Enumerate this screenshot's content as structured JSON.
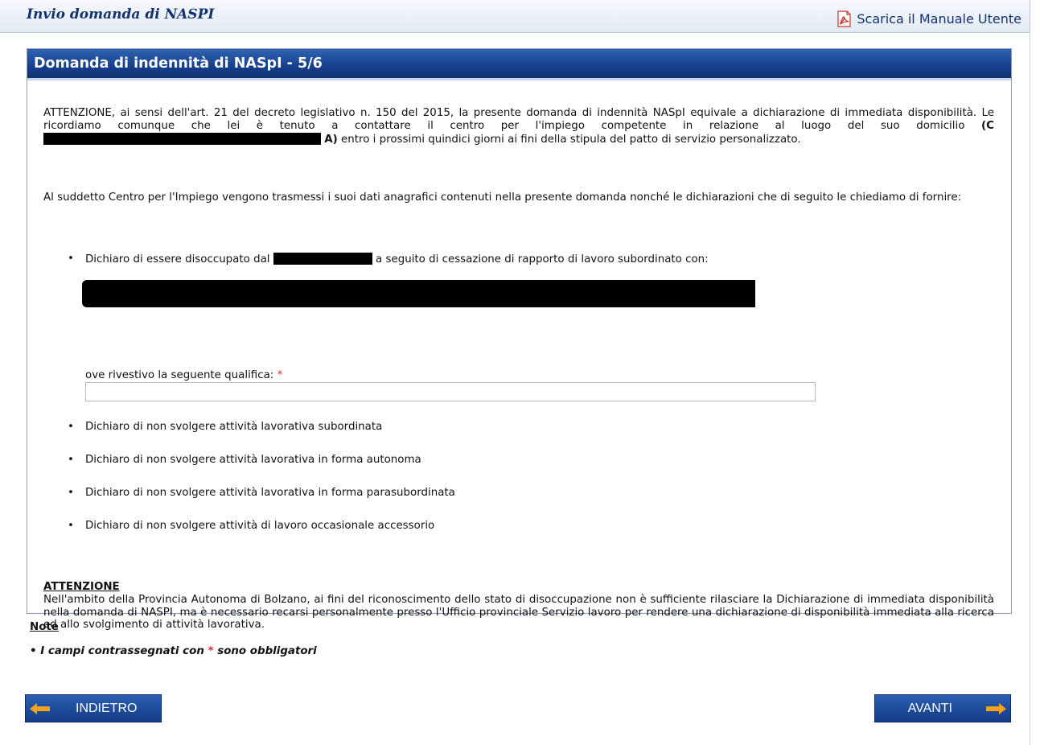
{
  "header": {
    "app_title": "Invio domanda di NASPI",
    "manual_link": "Scarica il Manuale Utente"
  },
  "panel": {
    "title": "Domanda di indennità di NASpI - 5/6",
    "para1_part1": "ATTENZIONE, ai sensi dell'art. 21 del decreto legislativo n. 150 del 2015, la presente domanda di indennità NASpI equivale a dichiarazione di immediata disponibilità. Le ricordiamo comunque che lei è tenuto a contattare il centro per l'impiego competente in relazione al luogo del suo domicilio ",
    "para1_bold_open": "(C",
    "para1_bold_close": "A)",
    "para1_part2": " entro i prossimi quindici giorni ai fini della stipula del patto di servizio personalizzato.",
    "para2": "Al suddetto Centro per l'Impiego vengono trasmessi i suoi dati anagrafici contenuti nella presente domanda nonché le dichiarazioni che di seguito le chiediamo di fornire:",
    "decl_unemployed_a": "Dichiaro di essere disoccupato dal",
    "decl_unemployed_b": "a seguito di cessazione di rapporto di lavoro subordinato con:",
    "qualification_label": "ove rivestivo la seguente qualifica:",
    "required_mark": "*",
    "qualification_value": "",
    "declarations": [
      "Dichiaro di non svolgere attività lavorativa subordinata",
      "Dichiaro di non svolgere attività lavorativa in forma autonoma",
      "Dichiaro di non svolgere attività lavorativa in forma parasubordinata",
      "Dichiaro di non svolgere attività di lavoro occasionale accessorio"
    ],
    "attention_title": "ATTENZIONE",
    "attention_text": "Nell'ambito della Provincia Autonoma di Bolzano, ai fini del riconoscimento dello stato di disoccupazione non è sufficiente rilasciare la Dichiarazione di immediata disponibilità nella domanda di NASPI, ma è necessario recarsi personalmente presso l'Ufficio provinciale Servizio lavoro per rendere una dichiarazione di disponibilità immediata alla ricerca ed allo svolgimento di attività lavorativa."
  },
  "notes": {
    "title": "Note",
    "item_a": "I campi contrassegnati con",
    "item_mark": "*",
    "item_b": "sono obbligatori"
  },
  "buttons": {
    "back": "INDIETRO",
    "next": "AVANTI"
  },
  "colors": {
    "header_blue": "#163f8d",
    "title_blue": "#12326e",
    "required_red": "#d62b2b",
    "arrow_orange": "#f5a21b"
  },
  "icons": {
    "manual": "pdf-icon",
    "back": "arrow-left-icon",
    "next": "arrow-right-icon"
  }
}
